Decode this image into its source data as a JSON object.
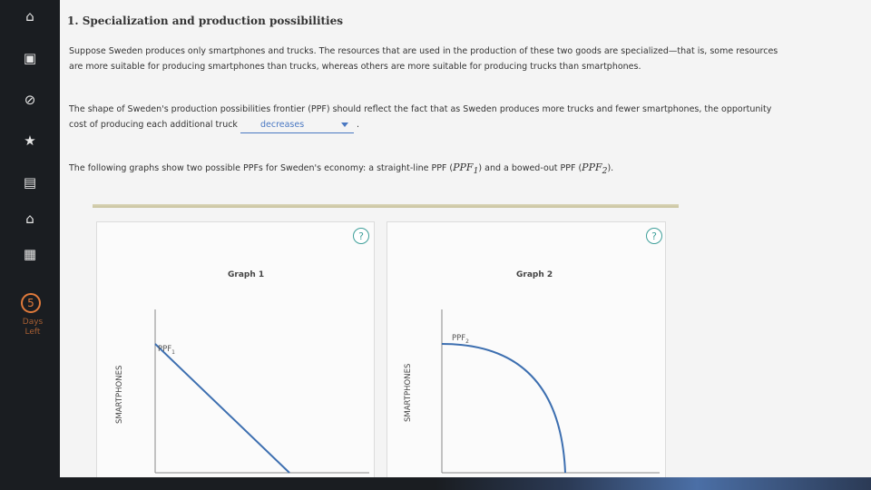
{
  "sidebar": {
    "items": [
      {
        "icon": "home-icon",
        "glyph": "⌂"
      },
      {
        "icon": "notebook-icon",
        "glyph": "▣"
      },
      {
        "icon": "compass-icon",
        "glyph": "⊘"
      },
      {
        "icon": "star-icon",
        "glyph": "★"
      },
      {
        "icon": "book-icon",
        "glyph": "▤"
      },
      {
        "icon": "graduation-cap-icon",
        "glyph": "⌂"
      },
      {
        "icon": "briefcase-icon",
        "glyph": "▦"
      }
    ],
    "days_left_number": "5",
    "days_left_label": "Days Left"
  },
  "problem": {
    "title": "1. Specialization and production possibilities",
    "para1": "Suppose Sweden produces only smartphones and trucks. The resources that are used in the production of these two goods are specialized—that is, some resources are more suitable for producing smartphones than trucks, whereas others are more suitable for producing trucks than smartphones.",
    "para2_before": "The shape of Sweden's production possibilities frontier (PPF) should reflect the fact that as Sweden produces more trucks and fewer smartphones, the opportunity cost of producing each additional truck",
    "para2_after": ".",
    "dropdown_value": "decreases",
    "para3_before": "The following graphs show two possible PPFs for Sweden's economy: a straight-line PPF (",
    "para3_ppf1": "PPF",
    "para3_ppf1_sub": "1",
    "para3_mid": ") and a bowed-out PPF (",
    "para3_ppf2": "PPF",
    "para3_ppf2_sub": "2",
    "para3_after": ")."
  },
  "graph1": {
    "help": "?",
    "title": "Graph 1",
    "ylabel": "SMARTPHONES",
    "curve_label": "PPF",
    "curve_sub": "1"
  },
  "graph2": {
    "help": "?",
    "title": "Graph 2",
    "ylabel": "SMARTPHONES",
    "curve_label": "PPF",
    "curve_sub": "2"
  },
  "colors": {
    "curve": "#3d6fb0",
    "accent": "#4a78c2",
    "help": "#3f9f9a",
    "days": "#e07a3b"
  }
}
